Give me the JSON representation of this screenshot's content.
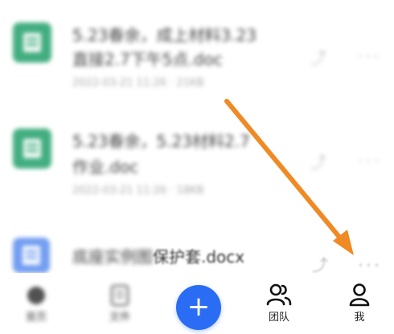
{
  "files": [
    {
      "name_line1": "5.23春余，成上材料3.23",
      "name_line2": "直接2.7下午5点.doc",
      "meta": "2022-03-21 11:26 · 21KB",
      "icon": "word-doc-icon",
      "icon_color": "#22a06b"
    },
    {
      "name_line1": "5.23春余，5.23材料2.7",
      "name_line2": "作业.doc",
      "meta": "2022-03-21 11:26 · 18KB",
      "icon": "word-doc-icon",
      "icon_color": "#22a06b"
    },
    {
      "name_blurred": "底座实例图",
      "name_visible": "保护套.docx",
      "icon": "doc-icon",
      "icon_color": "#5b8def"
    }
  ],
  "more_glyph": "···",
  "share_glyph": "⤴",
  "bottom_nav": {
    "items": [
      {
        "label": "首页",
        "icon": "home-icon"
      },
      {
        "label": "文件",
        "icon": "files-icon"
      },
      {
        "label": "团队",
        "icon": "team-icon"
      },
      {
        "label": "我",
        "icon": "profile-icon"
      }
    ],
    "add_label": "+"
  },
  "accent_color": "#2a6df4",
  "annotation_color": "#f08a24"
}
